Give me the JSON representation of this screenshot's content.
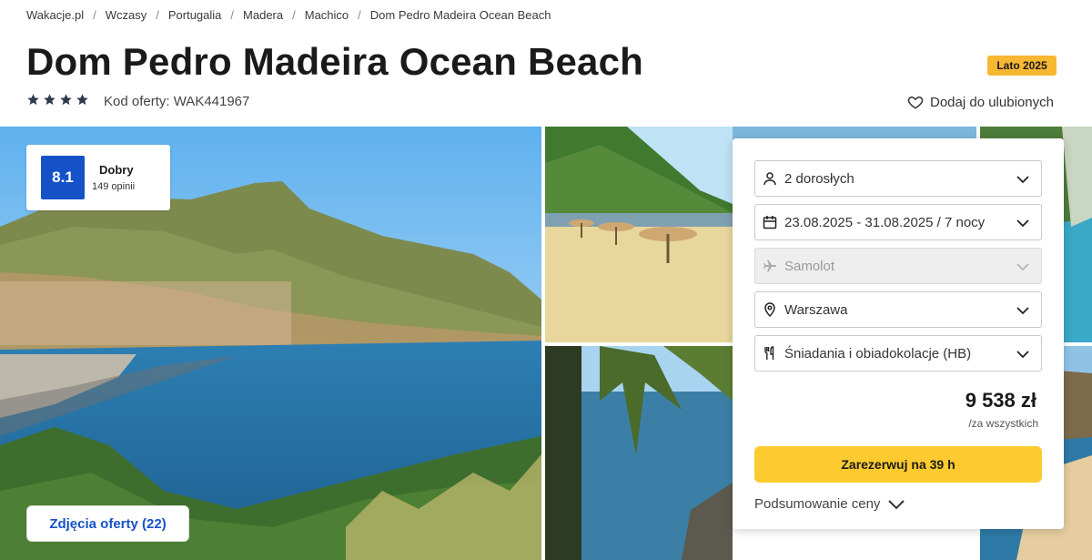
{
  "breadcrumb": [
    {
      "label": "Wakacje.pl"
    },
    {
      "label": "Wczasy"
    },
    {
      "label": "Portugalia"
    },
    {
      "label": "Madera"
    },
    {
      "label": "Machico"
    },
    {
      "label": "Dom Pedro Madeira Ocean Beach"
    }
  ],
  "breadcrumb_separator": "/",
  "hotel": {
    "name": "Dom Pedro Madeira Ocean Beach",
    "stars": 4,
    "offer_code": "Kod oferty: WAK441967",
    "season_badge": "Lato 2025",
    "favorite_label": "Dodaj do ulubionych"
  },
  "rating": {
    "score": "8.1",
    "label": "Dobry",
    "count": "149 opinii"
  },
  "photos_button": "Zdjęcia oferty (22)",
  "booking": {
    "travelers": "2 dorosłych",
    "dates": "23.08.2025 - 31.08.2025 / 7 nocy",
    "transport": "Samolot",
    "departure": "Warszawa",
    "board": "Śniadania i obiadokolacje (HB)",
    "price": "9 538 zł",
    "price_note": "/za wszystkich",
    "reserve_label": "Zarezerwuj na 39 h",
    "summary_label": "Podsumowanie ceny"
  },
  "icons": {
    "travelers": "user-icon",
    "dates": "calendar-icon",
    "transport": "plane-icon",
    "departure": "location-pin-icon",
    "board": "cutlery-icon",
    "favorite": "heart-icon",
    "star": "star-icon"
  },
  "colors": {
    "brand_blue": "#1552c8",
    "reserve_yellow": "#fdcb2f",
    "badge_orange": "#f7b733",
    "star_color": "#2f3a4a"
  }
}
